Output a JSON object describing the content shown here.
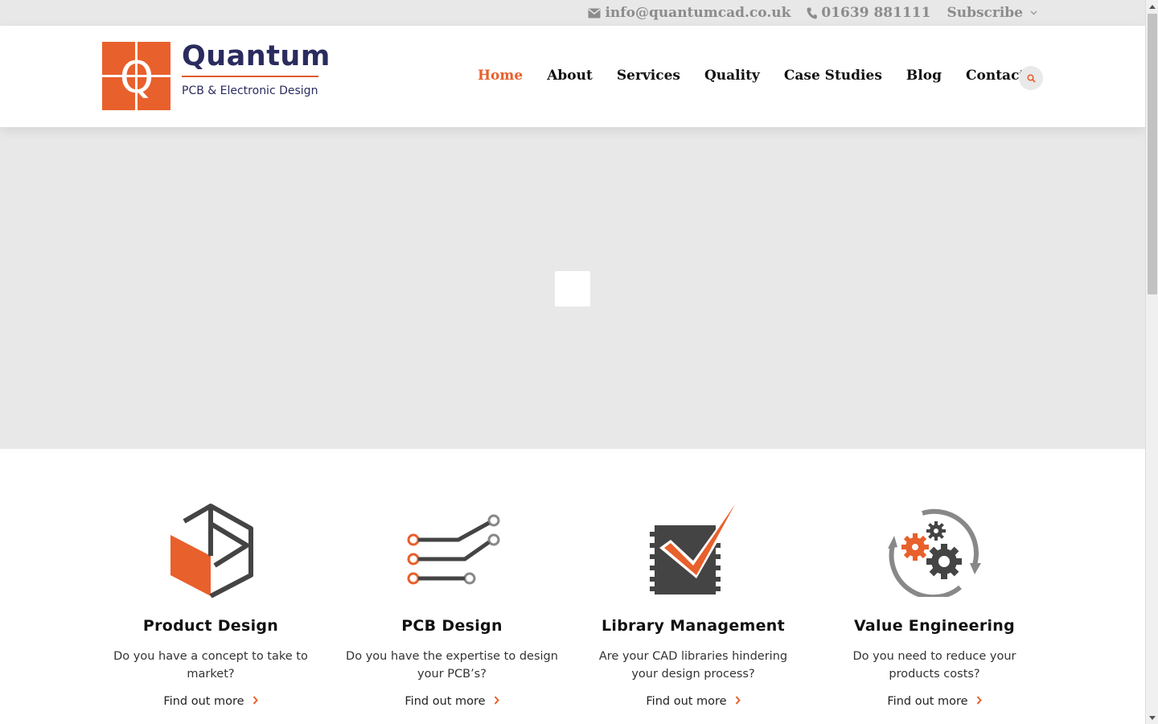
{
  "topbar": {
    "email": "info@quantumcad.co.uk",
    "phone": "01639 881111",
    "subscribe": "Subscribe",
    "email_icon": "envelope-icon",
    "phone_icon": "phone-icon"
  },
  "brand": {
    "name": "Quantum",
    "tagline": "PCB & Electronic Design",
    "logo_letter": "Q",
    "accent": "#e8602c",
    "navy": "#2a2b5e"
  },
  "nav": {
    "items": [
      {
        "label": "Home",
        "active": true
      },
      {
        "label": "About"
      },
      {
        "label": "Services"
      },
      {
        "label": "Quality"
      },
      {
        "label": "Case Studies"
      },
      {
        "label": "Blog"
      },
      {
        "label": "Contact"
      }
    ],
    "search_icon": "search-icon"
  },
  "features": [
    {
      "title": "Product Design",
      "desc": "Do you have a concept to take to market?",
      "link": "Find out more",
      "icon": "cube-icon"
    },
    {
      "title": "PCB Design",
      "desc": "Do you have the expertise to design your PCB’s?",
      "link": "Find out more",
      "icon": "circuit-traces-icon"
    },
    {
      "title": "Library Management",
      "desc": "Are your CAD libraries hindering your design process?",
      "link": "Find out more",
      "icon": "chip-checkmark-icon"
    },
    {
      "title": "Value Engineering",
      "desc": "Do you need to reduce your products costs?",
      "link": "Find out more",
      "icon": "gears-cycle-icon"
    }
  ]
}
